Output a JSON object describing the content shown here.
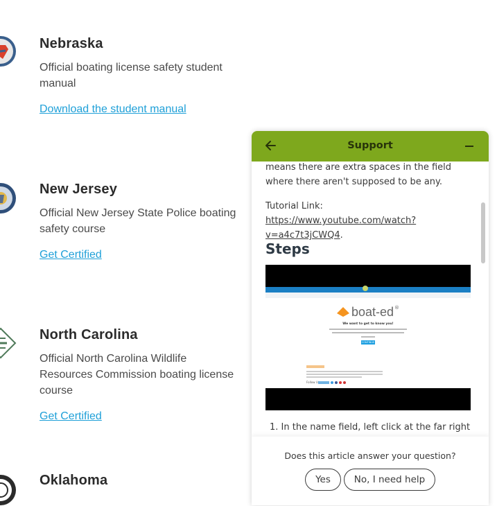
{
  "states": [
    {
      "name": "Nebraska",
      "description": "Official boating license safety student manual",
      "link": "Download the student manual"
    },
    {
      "name": "New Jersey",
      "description": "Official New Jersey State Police boating safety course",
      "link": "Get Certified"
    },
    {
      "name": "North Carolina",
      "description": "Official North Carolina Wildlife Resources Commission boating license course",
      "link": "Get Certified"
    },
    {
      "name": "Oklahoma"
    }
  ],
  "support": {
    "title": "Support",
    "intro_text": "means there are extra spaces in the field where there aren't supposed to be any.",
    "tutorial_label": "Tutorial Link: ",
    "tutorial_url_line1": "https://www.youtube.com/watch?",
    "tutorial_url_line2": "v=a4c7t3jCWQ4",
    "tutorial_period": ".",
    "steps_heading": "Steps",
    "screenshot": {
      "logo_text": "boat-ed",
      "logo_mark": "®",
      "tagline": "We want to get to know you!",
      "button": "CONTINUE",
      "follow_label": "Follow Us:"
    },
    "step_1": "In the name field, left click at the far right of",
    "footer_question": "Does this article answer your question?",
    "yes_label": "Yes",
    "no_label": "No, I need help"
  },
  "colors": {
    "accent": "#7ea81d",
    "link": "#1fa0d8",
    "boat_ed_orange": "#f5941f"
  }
}
